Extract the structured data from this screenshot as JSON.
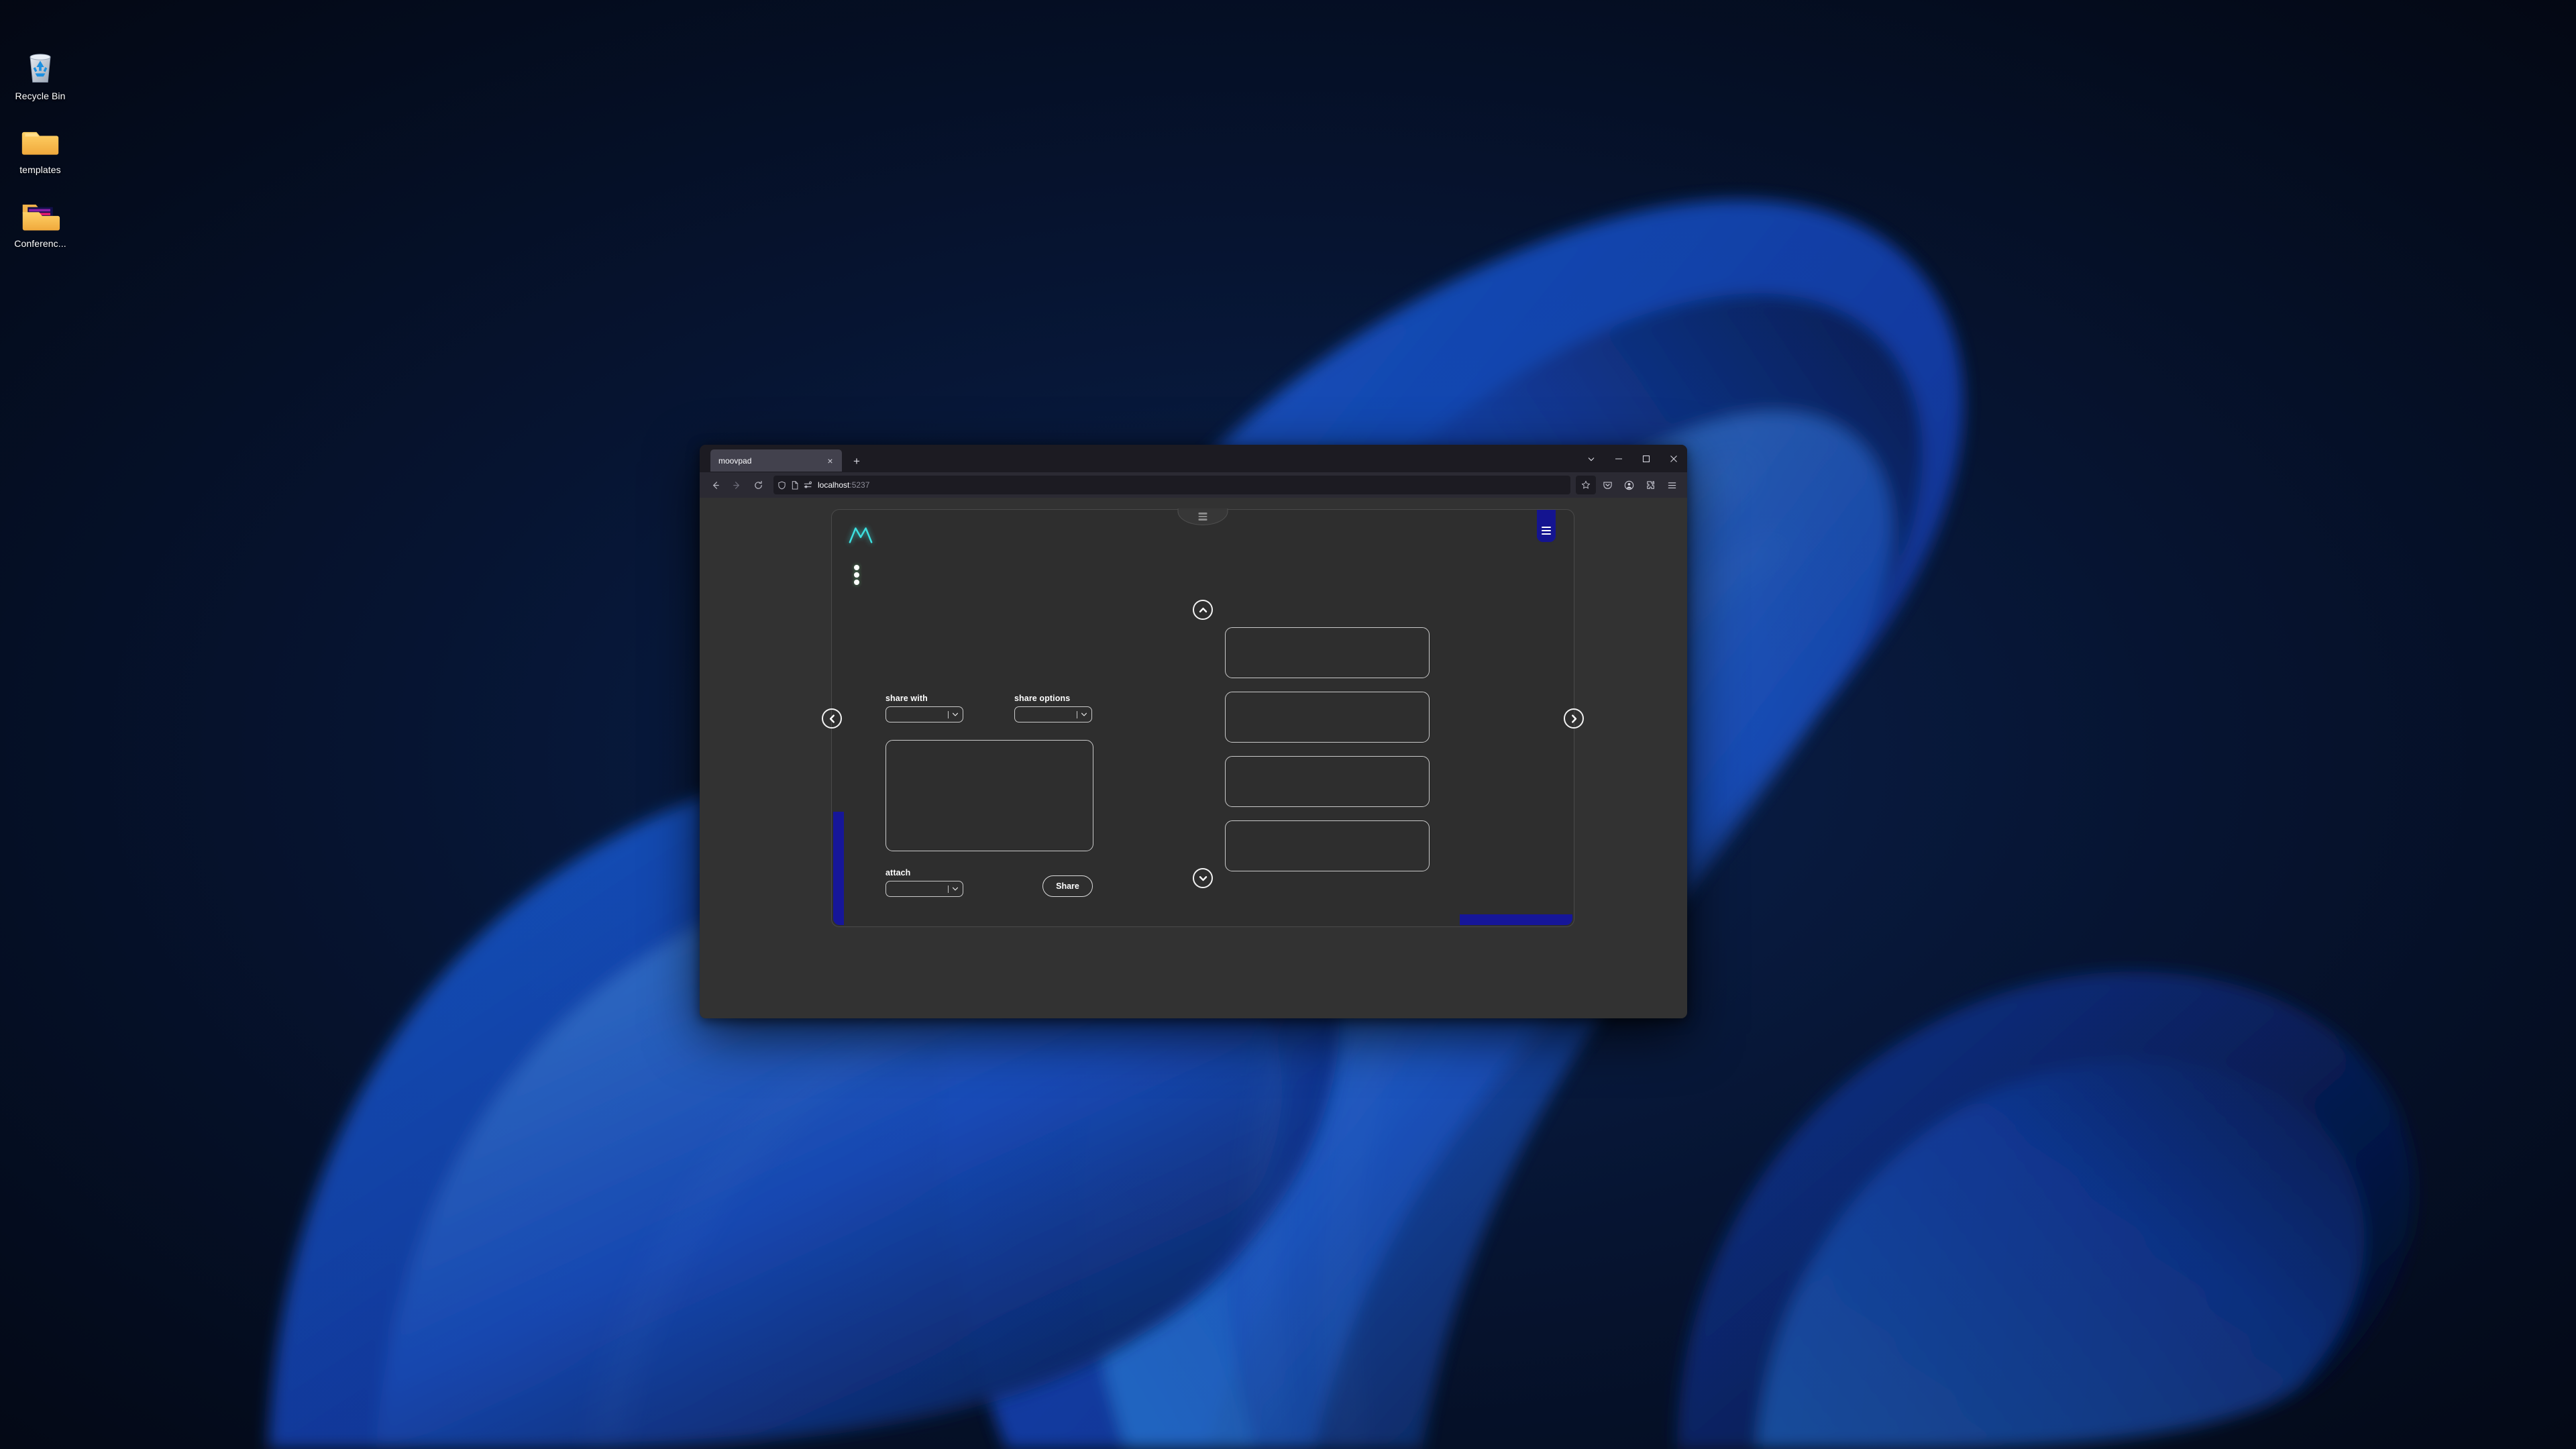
{
  "desktop": {
    "icons": [
      {
        "name": "recycle-bin",
        "label": "Recycle Bin"
      },
      {
        "name": "templates-folder",
        "label": "templates"
      },
      {
        "name": "conference-folder",
        "label": "Conferenc..."
      }
    ]
  },
  "browser": {
    "tab": {
      "title": "moovpad",
      "close_label": "×"
    },
    "new_tab_label": "+",
    "window_controls": {
      "list_tabs": "list-all-tabs",
      "minimize": "minimize",
      "maximize": "maximize",
      "close": "close"
    },
    "nav": {
      "back": "back",
      "forward": "forward",
      "reload": "reload"
    },
    "url": {
      "host": "localhost",
      "port": ":5237",
      "shield_icon": "shield-icon",
      "page_icon": "page-icon",
      "permissions_icon": "permissions-icon"
    },
    "toolbar": {
      "bookmark": "star-icon",
      "pocket": "pocket-icon",
      "account": "account-icon",
      "extensions": "extensions-icon",
      "app_menu": "hamburger-icon"
    }
  },
  "app": {
    "logo_alt": "moovpad-logo",
    "kebab_alt": "more-options",
    "top_handle_alt": "top-drawer-handle",
    "right_tab_alt": "right-drawer-handle",
    "left_strip_alt": "left-accent-strip",
    "bottom_bar_alt": "bottom-accent-bar",
    "nav": {
      "up": "⌃",
      "down": "⌄",
      "left": "‹",
      "right": "›"
    },
    "form": {
      "share_with_label": "share with",
      "share_with_value": "",
      "share_options_label": "share options",
      "share_options_value": "",
      "attach_label": "attach",
      "attach_value": "",
      "message_value": "",
      "share_button": "Share"
    },
    "right_panel": {
      "box1_value": "",
      "box2_value": "",
      "box3_value": "",
      "box4_value": ""
    },
    "colors": {
      "accent_blue": "#161699",
      "logo_cyan": "#3de0e0",
      "card_bg": "#2e2e2e",
      "page_bg": "#323232"
    }
  }
}
